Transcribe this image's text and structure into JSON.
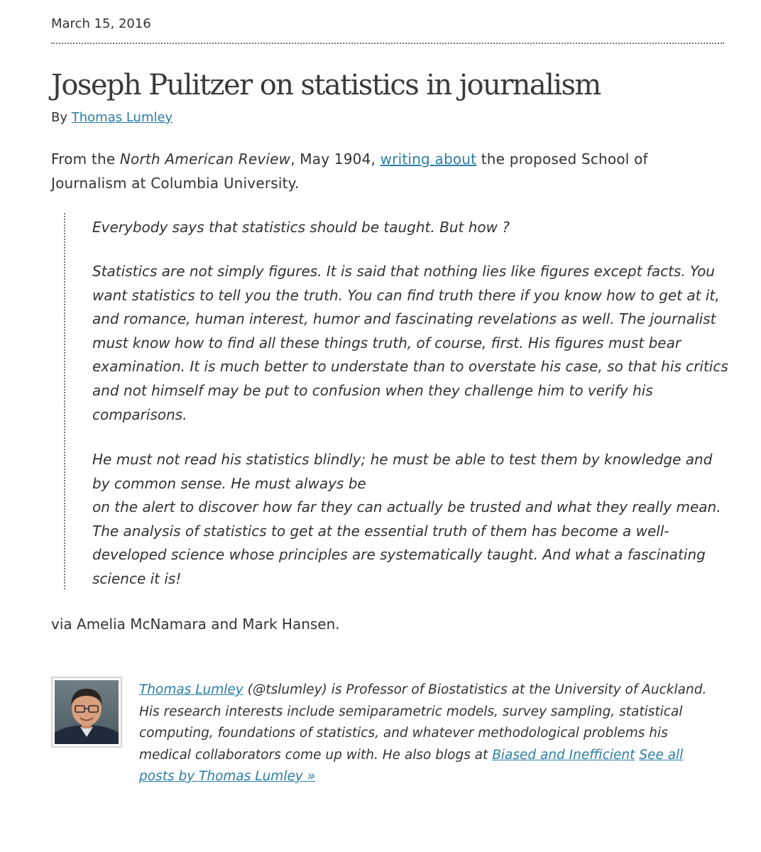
{
  "post": {
    "date": "March 15, 2016",
    "title": "Joseph Pulitzer on statistics in journalism",
    "byline_prefix": "By",
    "author_name": "Thomas Lumley"
  },
  "intro": {
    "from_prefix": "From the ",
    "publication": "North American Review",
    "date_text": ", May 1904, ",
    "link_text": "writing about",
    "suffix": " the proposed School of Journalism at Columbia University."
  },
  "quote": {
    "paragraph_1": "Everybody says that statistics should be taught. But how ?",
    "paragraph_2": "Statistics are not simply figures. It is said that nothing lies  like figures except facts. You want statistics to tell you the truth. You can find truth there if you know how to get at it, and  romance, human interest, humor and fascinating revelations as well. The journalist must know how to find all these things truth, of course, first. His figures must bear examination. It is much better to understate than to overstate his case, so that his critics and not himself may be put to confusion when they challenge him to verify his comparisons.",
    "paragraph_3_line_1": "He must not read his statistics blindly; he must be able to test them by knowledge and by common sense. He must always be",
    "paragraph_3_line_2": "on the alert to discover how far they can actually be trusted and what they really mean. The analysis of statistics to get at the essential truth of them has become a well-developed science whose principles are systematically taught. And what a fascinating science it is!"
  },
  "via_text": "via Amelia McNamara and Mark Hansen.",
  "author_box": {
    "name_link": "Thomas Lumley",
    "bio": " (@tslumley) is Professor of Biostatistics at the University of Auckland. His research interests include semiparametric models, survey sampling, statistical computing, foundations of statistics, and whatever methodological problems his medical collaborators come up with. He also blogs at ",
    "blog_link": "Biased and Inefficient",
    "all_posts_link": "See all posts by Thomas Lumley »"
  },
  "colors": {
    "link": "#2a7ea5",
    "text": "#333333",
    "title": "#3a3a3a"
  }
}
